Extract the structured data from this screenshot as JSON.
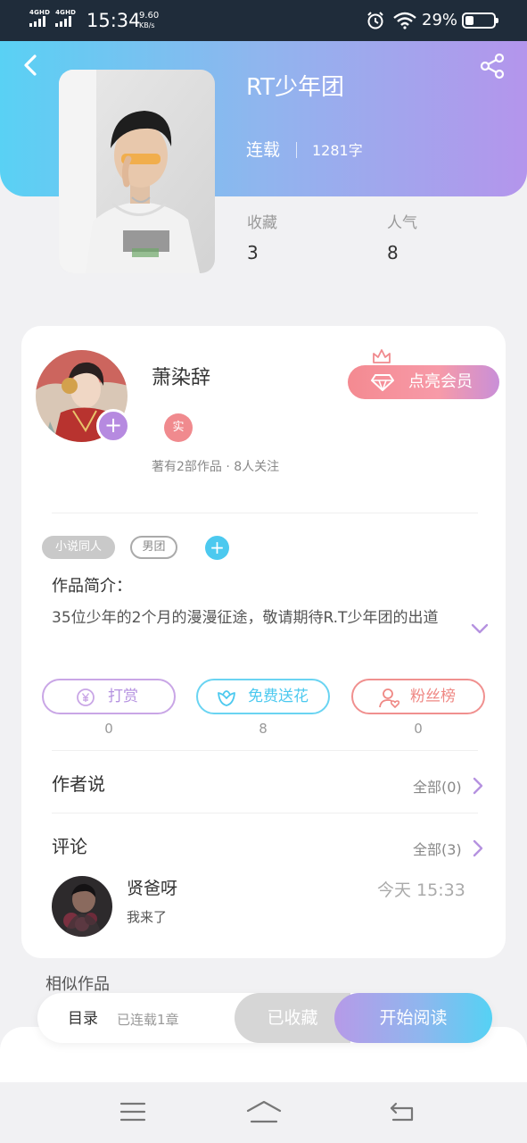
{
  "status_bar": {
    "network_1": "4GHD",
    "network_2": "4GHD",
    "time": "15:34",
    "speed_value": "9.60",
    "speed_unit": "KB/s",
    "battery_percent": "29%",
    "battery_level": 0.29
  },
  "header": {
    "back_icon": "chevron-left-icon",
    "share_icon": "share-icon",
    "gradient_colors": [
      "#59d1f4",
      "#b495ec"
    ]
  },
  "book": {
    "title": "RT少年团",
    "status": "连载",
    "word_count": "1281字",
    "stats": [
      {
        "label": "收藏",
        "value": "3"
      },
      {
        "label": "人气",
        "value": "8"
      }
    ]
  },
  "author": {
    "name": "萧染辞",
    "verified_badge": "实",
    "follow_button": "+",
    "meta": "著有2部作品 · 8人关注",
    "vip_button": "点亮会员"
  },
  "tags": {
    "items": [
      "小说同人",
      "男团"
    ],
    "add_button": "+"
  },
  "intro": {
    "title": "作品简介：",
    "text": "35位少年的2个月的漫漫征途，敬请期待R.T少年团的出道"
  },
  "actions": [
    {
      "label": "打赏",
      "count": "0",
      "icon": "yen-coin-icon"
    },
    {
      "label": "免费送花",
      "count": "8",
      "icon": "flower-icon"
    },
    {
      "label": "粉丝榜",
      "count": "0",
      "icon": "user-heart-icon"
    }
  ],
  "author_says": {
    "title": "作者说",
    "all_label": "全部(0)"
  },
  "comments": {
    "title": "评论",
    "all_label": "全部(3)",
    "items": [
      {
        "name": "贤爸呀",
        "time": "今天 15:33",
        "text": "我来了"
      }
    ]
  },
  "similar": {
    "title": "相似作品"
  },
  "bottom_bar": {
    "toc_label": "目录",
    "toc_sub": "已连载1章",
    "collected_label": "已收藏",
    "read_label": "开始阅读"
  },
  "nav": {
    "menu_icon": "menu-icon",
    "home_icon": "home-icon",
    "back_icon": "back-icon"
  },
  "colors": {
    "accent_purple": "#b592e0",
    "accent_cyan": "#4cc9ef",
    "accent_pink": "#ef8884"
  }
}
